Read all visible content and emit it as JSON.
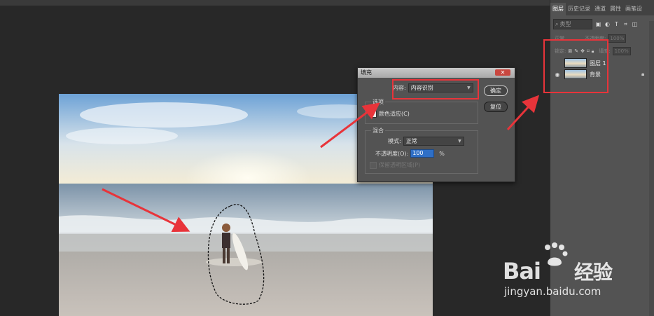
{
  "colors": {
    "accent_red": "#e8343a",
    "panel_bg": "#535353",
    "canvas_bg": "#282828",
    "highlight_blue": "#2f6fc6"
  },
  "layers_panel": {
    "tabs": [
      "图层",
      "历史记录",
      "通道",
      "属性",
      "画笔设"
    ],
    "filter_placeholder": "类型",
    "filter_icons": [
      "image-filter-icon",
      "adjust-filter-icon",
      "text-filter-icon",
      "shape-filter-icon",
      "smart-filter-icon"
    ],
    "blend_mode": "正常",
    "opacity_label": "不透明度:",
    "opacity_value": "100%",
    "lock_label": "锁定:",
    "fill_label": "填充:",
    "fill_value": "100%",
    "layers": [
      {
        "name": "图层 1",
        "visible": false,
        "locked": false
      },
      {
        "name": "背景",
        "visible": true,
        "locked": true
      }
    ]
  },
  "fill_dialog": {
    "title": "填充",
    "content_label": "内容:",
    "content_value": "内容识别",
    "ok_label": "确定",
    "reset_label": "复位",
    "options_group": "选项",
    "color_adapt_label": "颜色适应(C)",
    "color_adapt_checked": true,
    "blend_group": "混合",
    "mode_label": "模式:",
    "mode_value": "正常",
    "opacity_label": "不透明度(O):",
    "opacity_value": "100",
    "opacity_unit": "%",
    "preserve_label": "保留透明区域(P)",
    "preserve_checked": false
  },
  "watermark": {
    "brand": "Bai",
    "brand_cn": "经验",
    "url": "jingyan.baidu.com"
  }
}
